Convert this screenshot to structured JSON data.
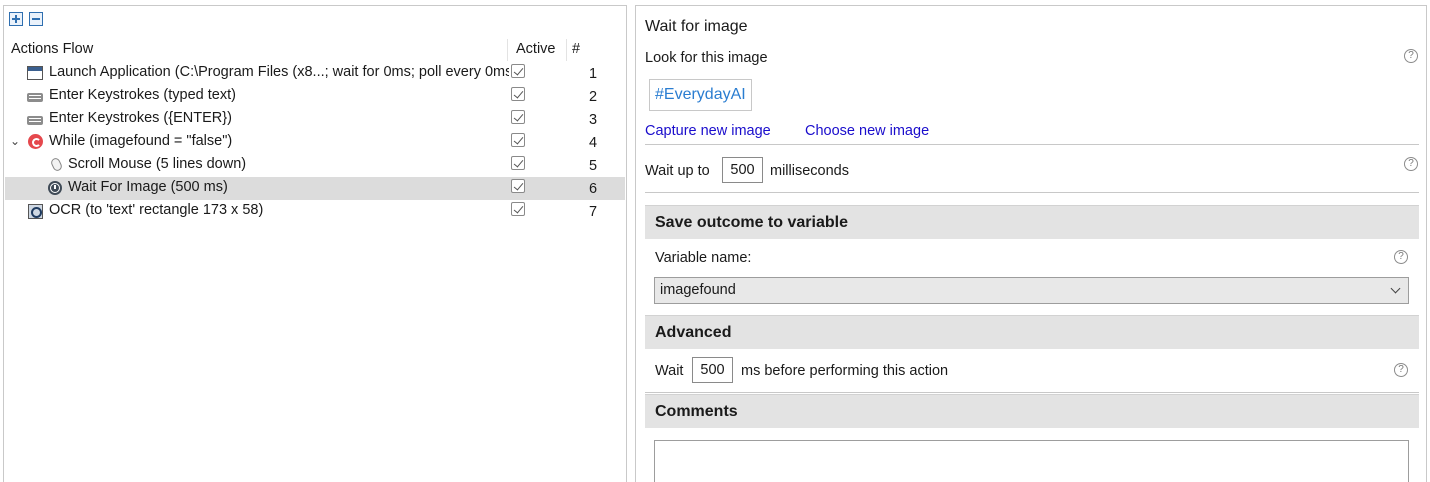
{
  "tree": {
    "headers": {
      "flow": "Actions Flow",
      "active": "Active",
      "num": "#"
    },
    "rows": [
      {
        "label": "Launch Application (C:\\Program Files (x8...; wait for 0ms; poll every 0ms)",
        "num": "1",
        "icon": "application-window-icon",
        "active": true
      },
      {
        "label": "Enter Keystrokes (typed text)",
        "num": "2",
        "icon": "keyboard-icon",
        "active": true
      },
      {
        "label": "Enter Keystrokes ({ENTER})",
        "num": "3",
        "icon": "keyboard-icon",
        "active": true
      },
      {
        "label": "While (imagefound = \"false\")",
        "num": "4",
        "icon": "loop-icon",
        "active": true
      },
      {
        "label": "Scroll Mouse (5 lines down)",
        "num": "5",
        "icon": "mouse-icon",
        "active": true
      },
      {
        "label": "Wait For Image (500 ms)",
        "num": "6",
        "icon": "clock-icon",
        "active": true
      },
      {
        "label": "OCR (to 'text' rectangle 173 x 58)",
        "num": "7",
        "icon": "ocr-icon",
        "active": true
      }
    ]
  },
  "panel": {
    "title": "Wait for image",
    "look_label": "Look for this image",
    "image_text": "#EverydayAI",
    "capture_link": "Capture new image",
    "choose_link": "Choose new image",
    "wait_prefix": "Wait up to",
    "wait_value": "500",
    "wait_suffix": "milliseconds",
    "save_section": "Save outcome to variable",
    "var_label": "Variable name:",
    "var_value": "imagefound",
    "advanced_section": "Advanced",
    "adv_prefix": "Wait",
    "adv_value": "500",
    "adv_suffix": "ms before performing this action",
    "comments_section": "Comments",
    "help_glyph": "?"
  }
}
